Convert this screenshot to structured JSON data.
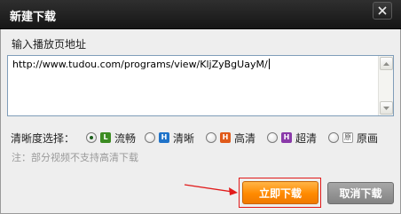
{
  "window": {
    "title": "新建下载"
  },
  "url_section": {
    "label": "输入播放页地址",
    "value": "http://www.tudou.com/programs/view/KljZyBgUayM/"
  },
  "quality": {
    "label": "清晰度选择：",
    "options": [
      {
        "icon_letter": "L",
        "label": "流畅",
        "checked": true,
        "icon_color": "#3c8c22"
      },
      {
        "icon_letter": "H",
        "label": "清晰",
        "checked": false,
        "icon_color": "#1f73c9"
      },
      {
        "icon_letter": "H",
        "label": "高清",
        "checked": false,
        "icon_color": "#e05a1a"
      },
      {
        "icon_letter": "H",
        "label": "超清",
        "checked": false,
        "icon_color": "#8a3aa9"
      },
      {
        "icon_letter": "原",
        "label": "原画",
        "checked": false,
        "icon_color": "#ffffff"
      }
    ]
  },
  "note": "注：部分视频不支持高清下载",
  "buttons": {
    "start": "立即下载",
    "cancel": "取消下载"
  },
  "colors": {
    "accent": "#ff8a00",
    "highlight": "#e11b1b"
  },
  "icons": {
    "close": "close-icon"
  }
}
